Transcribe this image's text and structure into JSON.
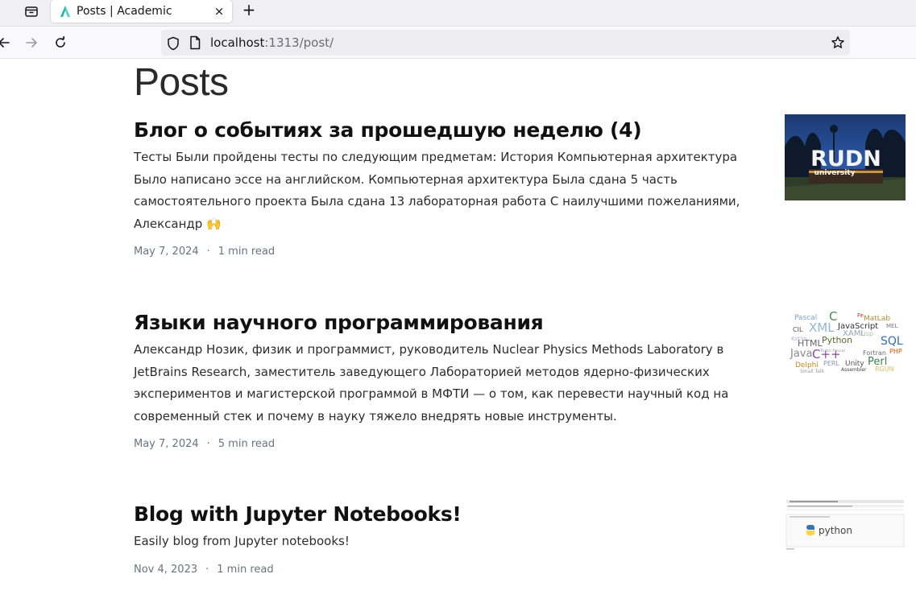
{
  "browser": {
    "tab_title": "Posts | Academic",
    "tab_close": "×",
    "new_tab": "+",
    "url_host": "localhost",
    "url_path": ":1313/post/"
  },
  "page": {
    "title": "Posts"
  },
  "posts": [
    {
      "title": "Блог о событиях за прошедшую неделю (4)",
      "summary": "Тесты Были пройдены тесты по следующим предметам: История Компьютерная архитектура Было написано эссе на английском. Компьютерная архитектура Была сдана 5 часть самостоятельного проекта Была сдана 13 лабораторная работа С наилучшими пожеланиями, Александр 🙌",
      "date": "May 7, 2024",
      "sep": "·",
      "reading_time": "1 min read",
      "thumb": {
        "text1": "RUDN",
        "text2": "university"
      }
    },
    {
      "title": "Языки научного программирования",
      "summary": "Александр Нозик, физик и программист, руководитель Nuclear Physics Methods Laboratory в JetBrains Research, заместитель заведующего Лабораторией методов ядерно-физических экспериментов и магистерской программой в МФТИ — о том, как перевести научный код на современный стек и почему в науку тяжело внедрять новые инструменты.",
      "date": "May 7, 2024",
      "sep": "·",
      "reading_time": "5 min read",
      "thumb": {
        "words": [
          "Pascal",
          "C",
          "Fe",
          "MatLab",
          "CIL",
          "XML",
          "JavaScript",
          "MEL",
          "Kotlin",
          "XAML",
          "HTML",
          "Python",
          "Lisp",
          "SQL",
          "Java",
          "C++",
          "Fortran",
          "PHP",
          "Delphi",
          "PERL",
          "Unity",
          "Perl",
          "Small Talk",
          "Assembler",
          "RGUN",
          "Turbo Pascal"
        ]
      }
    },
    {
      "title": "Blog with Jupyter Notebooks!",
      "summary": "Easily blog from Jupyter notebooks!",
      "date": "Nov 4, 2023",
      "sep": "·",
      "reading_time": "1 min read",
      "thumb": {
        "text": "python"
      }
    }
  ]
}
